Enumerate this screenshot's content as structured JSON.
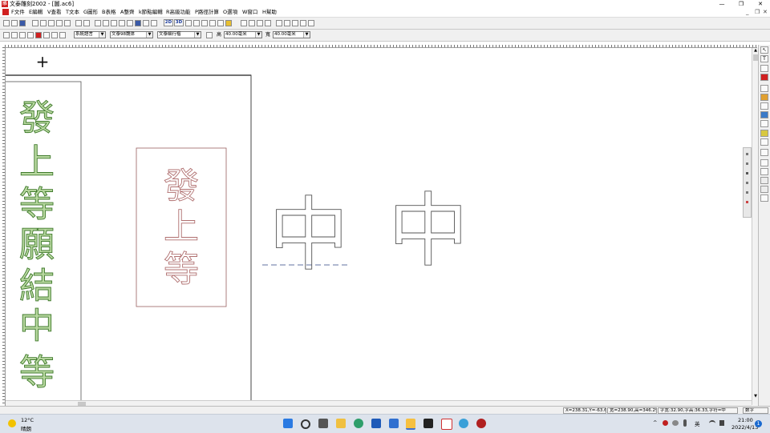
{
  "window": {
    "app_icon_char": "雕",
    "title": "文泰雕刻2002 - [圖.ac6]",
    "minimize": "—",
    "restore": "❐",
    "close": "✕",
    "mdi_min": "_",
    "mdi_restore": "❐",
    "mdi_close": "✕"
  },
  "menu": [
    {
      "label": "F文件"
    },
    {
      "label": "E編輯"
    },
    {
      "label": "V查看"
    },
    {
      "label": "T文本"
    },
    {
      "label": "G圖形"
    },
    {
      "label": "B表格"
    },
    {
      "label": "A整齊"
    },
    {
      "label": "k節點編輯"
    },
    {
      "label": "R高級功能"
    },
    {
      "label": "P路徑計算"
    },
    {
      "label": "O選項"
    },
    {
      "label": "W窗口"
    },
    {
      "label": "H幫助"
    }
  ],
  "toolbar1": {
    "btn_2d": "2D",
    "btn_3d": "3D"
  },
  "toolbar2": {
    "font_lang": "系統語言",
    "font_name": "文泰98魏体",
    "font_style": "文泰細行楷",
    "height_label": "高",
    "height_value": "40.00毫米",
    "width_label": "寬",
    "width_value": "40.00毫米"
  },
  "canvas": {
    "crosshair": "+",
    "vertical_text": [
      "發",
      "上",
      "等",
      "願",
      "結",
      "中",
      "等"
    ],
    "box_text": [
      "發",
      "上",
      "等"
    ],
    "large_char_1": "中",
    "large_char_2": "中",
    "colors": {
      "green_fill": "#b8d8a0",
      "green_stroke": "#3f7a2b",
      "pink_stroke": "#b07070",
      "page_border": "#444444"
    }
  },
  "status": {
    "coords": "X=238.31,Y=-63.6",
    "size": "宽=238.90,高=346.29",
    "char": "字宽:32.90,字高:36.33,字符=中",
    "mode": "数字"
  },
  "taskbar": {
    "weather_temp": "12°C",
    "weather_desc": "晴朗",
    "ime": "英",
    "time": "21:00",
    "date": "2022/4/13",
    "notif_count": "1"
  }
}
